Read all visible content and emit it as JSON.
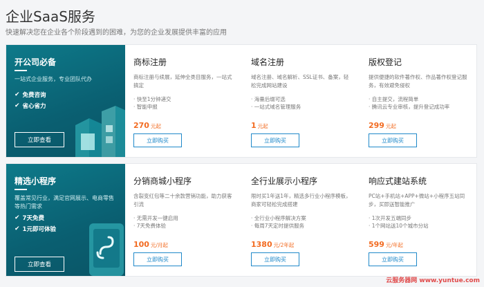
{
  "header": {
    "title": "企业SaaS服务",
    "subtitle": "快速解决您在企业各个阶段遇到的困难，为您的企业发展提供丰富的应用"
  },
  "sections": [
    {
      "promo": {
        "title": "开公司必备",
        "desc": "一站式企业服务，专业团队代办",
        "features": [
          "免费咨询",
          "省心省力"
        ],
        "button": "立即查看"
      },
      "cards": [
        {
          "title": "商标注册",
          "desc": "商标注册与续展，延伸全类目服务，一站式搞定",
          "features": [
            "· 快至1分钟递交",
            "· 智能申报"
          ],
          "price": "270",
          "unit": "元起",
          "button": "立即购买"
        },
        {
          "title": "域名注册",
          "desc": "域名注册、域名解析、SSL证书、备案，轻松完成网站建设",
          "features": [
            "· 海量后缀可选",
            "· 一站式域名管理服务"
          ],
          "price": "1",
          "unit": "元起",
          "button": "立即购买"
        },
        {
          "title": "版权登记",
          "desc": "提供便捷的软件著作权、作品著作权登记服务，有效避免侵权",
          "features": [
            "· 自主提交，流程简单",
            "· 腾讯云专业审核，提升登记成功率"
          ],
          "price": "299",
          "unit": "元起",
          "button": "立即购买"
        }
      ]
    },
    {
      "promo": {
        "title": "精选小程序",
        "desc": "覆盖常见行业，满足官网展示、电商零售等热门需求",
        "features": [
          "7天免费",
          "1元即可体验"
        ],
        "button": "立即查看"
      },
      "cards": [
        {
          "title": "分销商城小程序",
          "desc": "含裂变红包等二十余款营销功能，助力获客引流",
          "features": [
            "· 无需开发一键启用",
            "· 7天免费体验"
          ],
          "price": "100",
          "unit": "元/月起",
          "button": "立即购买"
        },
        {
          "title": "全行业展示小程序",
          "desc": "限时买1年送1年，精选多行业小程序模板，商家可轻松完成搭建",
          "features": [
            "· 全行业小程序解决方案",
            "· 每周7天定时提供服务"
          ],
          "price": "1380",
          "unit": "元/2年起",
          "button": "立即购买"
        },
        {
          "title": "响应式建站系统",
          "desc": "PC站+手机站+APP+微站+小程序五站同步，买即送智能推广",
          "features": [
            "· 1次开发五端同步",
            "· 1个网站送10个城市分站"
          ],
          "price": "599",
          "unit": "元/年起",
          "button": "立即购买"
        }
      ]
    }
  ],
  "watermark": "云服务器网 www.yuntue.com",
  "colors": {
    "accent": "#1e88c9",
    "price": "#f26b21",
    "promo_bg": "#0a5f71"
  }
}
